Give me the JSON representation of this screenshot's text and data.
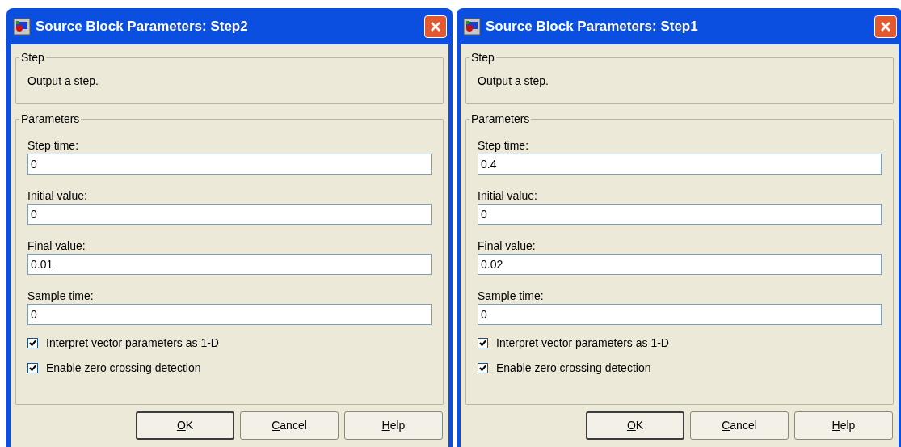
{
  "dialogs": [
    {
      "title": "Source Block Parameters: Step2",
      "active": true,
      "step_group": {
        "label": "Step",
        "description": "Output a step."
      },
      "parameters_group": {
        "label": "Parameters",
        "fields": [
          {
            "label": "Step time:",
            "value": "0"
          },
          {
            "label": "Initial value:",
            "value": "0"
          },
          {
            "label": "Final value:",
            "value": "0.01"
          },
          {
            "label": "Sample time:",
            "value": "0"
          }
        ],
        "checkboxes": [
          {
            "label": "Interpret vector parameters as 1-D",
            "checked": true
          },
          {
            "label": "Enable zero crossing detection",
            "checked": true
          }
        ]
      },
      "buttons": [
        {
          "label": "OK",
          "default": true
        },
        {
          "label": "Cancel",
          "default": false
        },
        {
          "label": "Help",
          "default": false
        }
      ]
    },
    {
      "title": "Source Block Parameters: Step1",
      "active": true,
      "step_group": {
        "label": "Step",
        "description": "Output a step."
      },
      "parameters_group": {
        "label": "Parameters",
        "fields": [
          {
            "label": "Step time:",
            "value": "0.4"
          },
          {
            "label": "Initial value:",
            "value": "0"
          },
          {
            "label": "Final value:",
            "value": "0.02"
          },
          {
            "label": "Sample time:",
            "value": "0"
          }
        ],
        "checkboxes": [
          {
            "label": "Interpret vector parameters as 1-D",
            "checked": true
          },
          {
            "label": "Enable zero crossing detection",
            "checked": true
          }
        ]
      },
      "buttons": [
        {
          "label": "OK",
          "default": true
        },
        {
          "label": "Cancel",
          "default": false
        },
        {
          "label": "Help",
          "default": false
        }
      ]
    }
  ]
}
